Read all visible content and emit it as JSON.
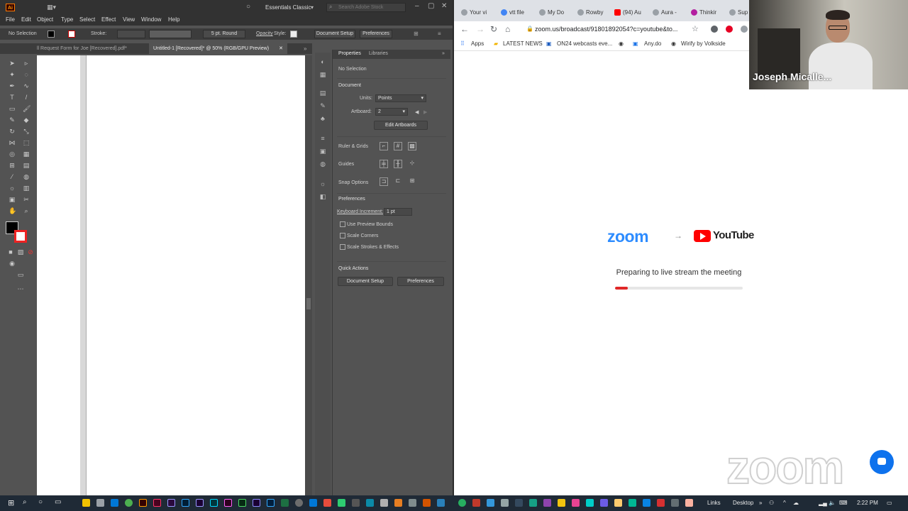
{
  "illustrator": {
    "logo": "Ai",
    "workspace": "Essentials Classic",
    "search_placeholder": "Search Adobe Stock",
    "menu": [
      "File",
      "Edit",
      "Object",
      "Type",
      "Select",
      "Effect",
      "View",
      "Window",
      "Help"
    ],
    "control": {
      "selection": "No Selection",
      "stroke_label": "Stroke:",
      "brush": "5 pt. Round",
      "opacity_label": "Opacity",
      "style_label": "Style:",
      "doc_setup": "Document Setup",
      "preferences": "Preferences"
    },
    "doc_tabs": [
      {
        "label": "ll Request Form for Joe [Recovered].pdf*"
      },
      {
        "label": "Untitled-1 [Recovered]* @ 50% (RGB/GPU Preview)"
      }
    ],
    "properties": {
      "tabs": [
        "Properties",
        "Libraries"
      ],
      "selection": "No Selection",
      "document_header": "Document",
      "units_label": "Units:",
      "units_value": "Points",
      "artboard_label": "Artboard:",
      "artboard_value": "2",
      "edit_artboards": "Edit Artboards",
      "rulers_label": "Ruler & Grids",
      "guides_label": "Guides",
      "snap_label": "Snap Options",
      "preferences_header": "Preferences",
      "keyboard_inc_label": "Keyboard Increment:",
      "keyboard_inc_value": "1 pt",
      "checks": [
        "Use Preview Bounds",
        "Scale Corners",
        "Scale Strokes & Effects"
      ],
      "quick_actions": "Quick Actions",
      "doc_setup_btn": "Document Setup",
      "prefs_btn": "Preferences"
    }
  },
  "chrome": {
    "tabs": [
      {
        "label": "Your vi",
        "color": "#9aa0a6"
      },
      {
        "label": "vtt file",
        "color": "#4285f4"
      },
      {
        "label": "My Do",
        "color": "#9aa0a6"
      },
      {
        "label": "Rowby",
        "color": "#9aa0a6"
      },
      {
        "label": "(94) Au",
        "color": "#ff0000"
      },
      {
        "label": "Aura -",
        "color": "#9aa0a6"
      },
      {
        "label": "Thinkir",
        "color": "#b31fa0"
      },
      {
        "label": "Sup",
        "color": "#9aa0a6"
      }
    ],
    "url": "zoom.us/broadcast/91801892054?c=youtube&to...",
    "bookmarks": [
      "Apps",
      "LATEST NEWS",
      "ON24 webcasts eve...",
      "Any.do",
      "Wirify by Volkside"
    ],
    "page": {
      "zoom_logo": "zoom",
      "youtube_logo": "YouTube",
      "status": "Preparing to live stream the meeting",
      "progress_fraction": 0.1,
      "watermark": "zoom",
      "accent": "#2d8cff",
      "progress_color": "#e02828"
    }
  },
  "webcam": {
    "name": "Joseph Micalle..."
  },
  "taskbar": {
    "links": "Links",
    "desktop": "Desktop",
    "time": "2:22 PM"
  }
}
